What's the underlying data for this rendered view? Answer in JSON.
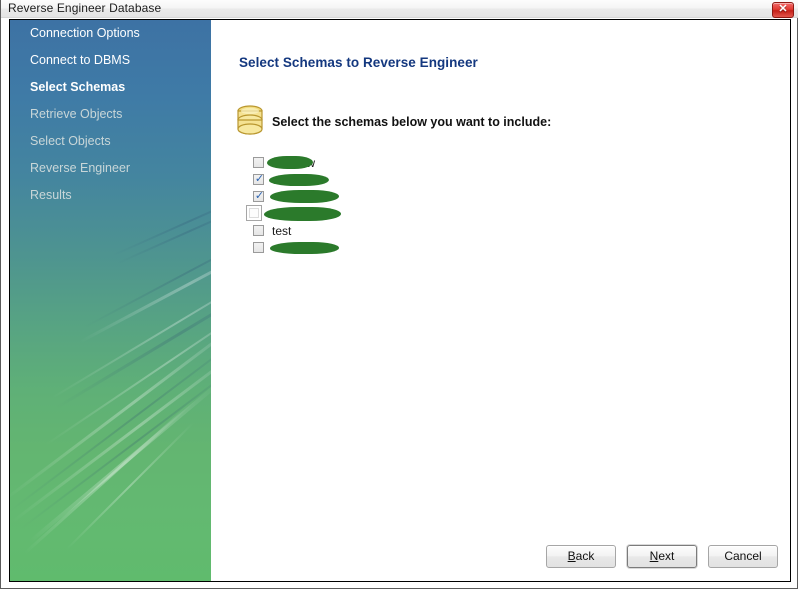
{
  "window": {
    "title": "Reverse Engineer Database",
    "close_label": "✕",
    "close_icon": "close-icon"
  },
  "sidebar": {
    "items": [
      {
        "label": "Connection Options",
        "state": "done"
      },
      {
        "label": "Connect to DBMS",
        "state": "done"
      },
      {
        "label": "Select Schemas",
        "state": "current"
      },
      {
        "label": "Retrieve Objects",
        "state": "pending"
      },
      {
        "label": "Select Objects",
        "state": "pending"
      },
      {
        "label": "Reverse Engineer",
        "state": "pending"
      },
      {
        "label": "Results",
        "state": "pending"
      }
    ]
  },
  "main": {
    "heading": "Select Schemas to Reverse Engineer",
    "icon": "database-icon",
    "instruction": "Select the schemas below you want to include:",
    "schemas": [
      {
        "label": "new",
        "checked": false,
        "hover": false,
        "redacted": true
      },
      {
        "label": "",
        "checked": true,
        "hover": false,
        "redacted": true
      },
      {
        "label": "",
        "checked": true,
        "hover": false,
        "redacted": true
      },
      {
        "label": "",
        "checked": false,
        "hover": true,
        "redacted": true
      },
      {
        "label": "test",
        "checked": false,
        "hover": false,
        "redacted": false
      },
      {
        "label": "",
        "checked": false,
        "hover": false,
        "redacted": true
      }
    ]
  },
  "buttons": {
    "back": "Back",
    "back_mnemonic": "B",
    "next": "Next",
    "next_mnemonic": "N",
    "cancel": "Cancel"
  },
  "colors": {
    "heading": "#14387f",
    "sidebar_top": "#3d72a4",
    "sidebar_bottom": "#60bb6d",
    "redaction": "#2b7a2b",
    "close_button": "#d32f26",
    "checkbox_tick": "#2b62b0"
  }
}
